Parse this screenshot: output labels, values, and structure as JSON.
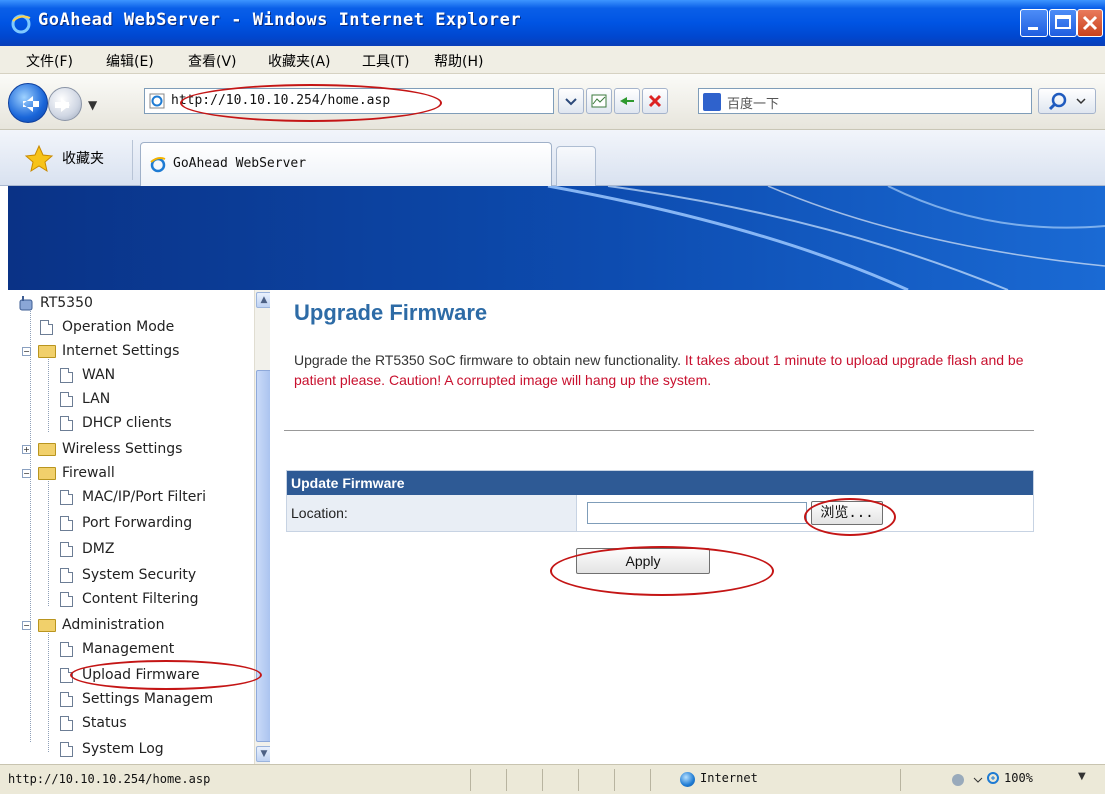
{
  "window": {
    "title": "GoAhead WebServer - Windows Internet Explorer"
  },
  "menu": [
    "文件(F)",
    "编辑(E)",
    "查看(V)",
    "收藏夹(A)",
    "工具(T)",
    "帮助(H)"
  ],
  "address_bar": {
    "url": "http://10.10.10.254/home.asp"
  },
  "search": {
    "placeholder": "百度一下"
  },
  "favorites": {
    "label": "收藏夹"
  },
  "tab": {
    "title": "GoAhead WebServer"
  },
  "tree": {
    "root": "RT5350",
    "items": [
      {
        "label": "Operation Mode"
      },
      {
        "label": "Internet Settings"
      },
      {
        "label": "WAN"
      },
      {
        "label": "LAN"
      },
      {
        "label": "DHCP clients"
      },
      {
        "label": "Wireless Settings"
      },
      {
        "label": "Firewall"
      },
      {
        "label": "MAC/IP/Port Filteri"
      },
      {
        "label": "Port Forwarding"
      },
      {
        "label": "DMZ"
      },
      {
        "label": "System Security"
      },
      {
        "label": "Content Filtering"
      },
      {
        "label": "Administration"
      },
      {
        "label": "Management"
      },
      {
        "label": "Upload Firmware"
      },
      {
        "label": "Settings Managem"
      },
      {
        "label": "Status"
      },
      {
        "label": "System Log"
      }
    ]
  },
  "page": {
    "title": "Upgrade Firmware",
    "desc_normal": "Upgrade the RT5350 SoC firmware to obtain new functionality. ",
    "desc_warning": "It takes about 1 minute to upload upgrade flash and be patient please. Caution! A corrupted image will hang up the system.",
    "table_header": "Update Firmware",
    "location_label": "Location:",
    "browse_label": "浏览...",
    "apply_label": "Apply"
  },
  "statusbar": {
    "url": "http://10.10.10.254/home.asp",
    "zone": "Internet",
    "zoom": "100%"
  },
  "colors": {
    "title_blue": "#2d6ba6",
    "warning_red": "#c8102e",
    "table_header": "#2e5a95",
    "annotation_red": "#c41515"
  }
}
